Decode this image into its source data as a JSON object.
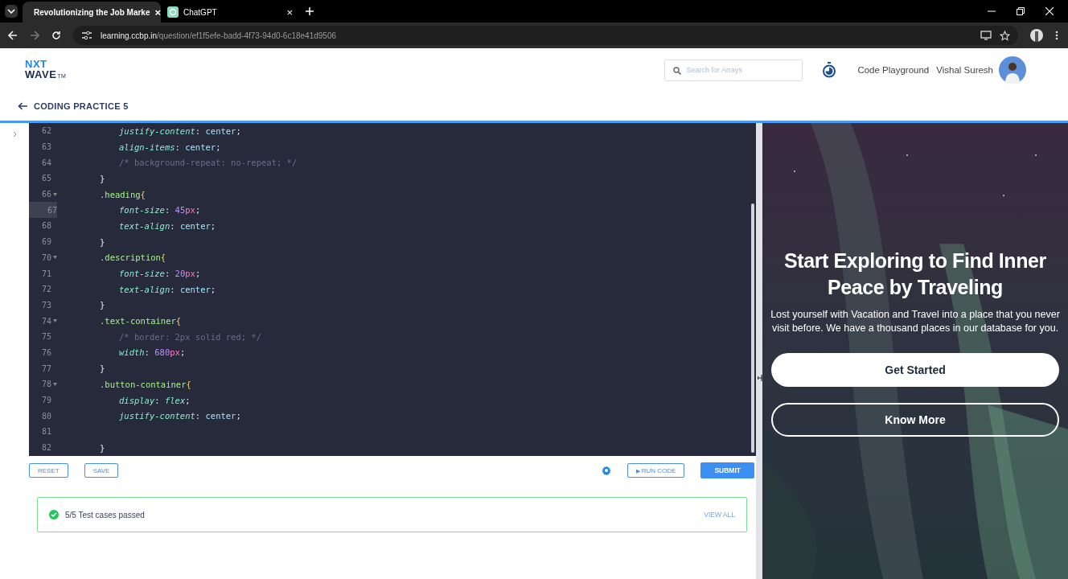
{
  "browser": {
    "tabs": [
      {
        "title": "Revolutionizing the Job Marke",
        "close": "×",
        "selected": true
      },
      {
        "title": "ChatGPT",
        "close": "×",
        "selected": false
      }
    ],
    "url_host": "learning.ccbp.in",
    "url_path": "/question/ef1f5efe-badd-4f73-94d0-6c18e41d9506"
  },
  "header": {
    "logo_top": "NXT",
    "logo_bottom": "WAVE",
    "logo_mark": "TM",
    "search": {
      "placeholder": "Search for Arrays"
    },
    "links": [
      "Code Playground",
      "Vishal Suresh"
    ],
    "breadcrumb": "CODING PRACTICE 5"
  },
  "editor": {
    "lines": [
      {
        "number": "62",
        "kind": "declaration",
        "foldable": false,
        "selected": false,
        "tokens": [
          {
            "kind": "prop",
            "text": "justify-content"
          },
          {
            "kind": "punct",
            "text": ": "
          },
          {
            "kind": "value",
            "text": "center"
          },
          {
            "kind": "punct",
            "text": ";"
          }
        ]
      },
      {
        "number": "63",
        "kind": "declaration",
        "foldable": false,
        "selected": false,
        "tokens": [
          {
            "kind": "prop",
            "text": "align-items"
          },
          {
            "kind": "punct",
            "text": ": "
          },
          {
            "kind": "value",
            "text": "center"
          },
          {
            "kind": "punct",
            "text": ";"
          }
        ]
      },
      {
        "number": "64",
        "kind": "declaration",
        "foldable": false,
        "selected": false,
        "tokens": [
          {
            "kind": "comment",
            "text": "/* background-repeat: no-repeat; */"
          }
        ]
      },
      {
        "number": "65",
        "kind": "rule",
        "foldable": false,
        "selected": false,
        "tokens": [
          {
            "kind": "punct",
            "text": "}"
          }
        ]
      },
      {
        "number": "66",
        "kind": "rule",
        "foldable": true,
        "selected": false,
        "tokens": [
          {
            "kind": "selector",
            "text": ".heading"
          },
          {
            "kind": "brace",
            "text": "{"
          }
        ]
      },
      {
        "number": "67",
        "kind": "declaration",
        "foldable": false,
        "selected": true,
        "tokens": [
          {
            "kind": "prop",
            "text": "font-size"
          },
          {
            "kind": "punct",
            "text": ": "
          },
          {
            "kind": "num",
            "text": "45"
          },
          {
            "kind": "unit",
            "text": "px"
          },
          {
            "kind": "punct",
            "text": ";"
          }
        ]
      },
      {
        "number": "68",
        "kind": "declaration",
        "foldable": false,
        "selected": false,
        "tokens": [
          {
            "kind": "prop",
            "text": "text-align"
          },
          {
            "kind": "punct",
            "text": ": "
          },
          {
            "kind": "value",
            "text": "center"
          },
          {
            "kind": "punct",
            "text": ";"
          }
        ]
      },
      {
        "number": "69",
        "kind": "rule",
        "foldable": false,
        "selected": false,
        "tokens": [
          {
            "kind": "punct",
            "text": "}"
          }
        ]
      },
      {
        "number": "70",
        "kind": "rule",
        "foldable": true,
        "selected": false,
        "tokens": [
          {
            "kind": "selector",
            "text": ".description"
          },
          {
            "kind": "brace",
            "text": "{"
          }
        ]
      },
      {
        "number": "71",
        "kind": "declaration",
        "foldable": false,
        "selected": false,
        "tokens": [
          {
            "kind": "prop",
            "text": "font-size"
          },
          {
            "kind": "punct",
            "text": ": "
          },
          {
            "kind": "num",
            "text": "20"
          },
          {
            "kind": "unit",
            "text": "px"
          },
          {
            "kind": "punct",
            "text": ";"
          }
        ]
      },
      {
        "number": "72",
        "kind": "declaration",
        "foldable": false,
        "selected": false,
        "tokens": [
          {
            "kind": "prop",
            "text": "text-align"
          },
          {
            "kind": "punct",
            "text": ": "
          },
          {
            "kind": "value",
            "text": "center"
          },
          {
            "kind": "punct",
            "text": ";"
          }
        ]
      },
      {
        "number": "73",
        "kind": "rule",
        "foldable": false,
        "selected": false,
        "tokens": [
          {
            "kind": "punct",
            "text": "}"
          }
        ]
      },
      {
        "number": "74",
        "kind": "rule",
        "foldable": true,
        "selected": false,
        "tokens": [
          {
            "kind": "selector",
            "text": ".text-container"
          },
          {
            "kind": "brace",
            "text": "{"
          }
        ]
      },
      {
        "number": "75",
        "kind": "declaration",
        "foldable": false,
        "selected": false,
        "tokens": [
          {
            "kind": "comment",
            "text": "/* border: 2px solid red; */"
          }
        ]
      },
      {
        "number": "76",
        "kind": "declaration",
        "foldable": false,
        "selected": false,
        "tokens": [
          {
            "kind": "prop",
            "text": "width"
          },
          {
            "kind": "punct",
            "text": ": "
          },
          {
            "kind": "num",
            "text": "680"
          },
          {
            "kind": "unit",
            "text": "px"
          },
          {
            "kind": "punct",
            "text": ";"
          }
        ]
      },
      {
        "number": "77",
        "kind": "rule",
        "foldable": false,
        "selected": false,
        "tokens": [
          {
            "kind": "punct",
            "text": "}"
          }
        ]
      },
      {
        "number": "78",
        "kind": "rule",
        "foldable": true,
        "selected": false,
        "tokens": [
          {
            "kind": "selector",
            "text": ".button-container"
          },
          {
            "kind": "brace",
            "text": "{"
          }
        ]
      },
      {
        "number": "79",
        "kind": "declaration",
        "foldable": false,
        "selected": false,
        "tokens": [
          {
            "kind": "prop",
            "text": "display"
          },
          {
            "kind": "punct",
            "text": ": "
          },
          {
            "kind": "keyword",
            "text": "flex"
          },
          {
            "kind": "punct",
            "text": ";"
          }
        ]
      },
      {
        "number": "80",
        "kind": "declaration",
        "foldable": false,
        "selected": false,
        "tokens": [
          {
            "kind": "prop",
            "text": "justify-content"
          },
          {
            "kind": "punct",
            "text": ": "
          },
          {
            "kind": "value",
            "text": "center"
          },
          {
            "kind": "punct",
            "text": ";"
          }
        ]
      },
      {
        "number": "81",
        "foldable": false,
        "selected": false
      },
      {
        "number": "82",
        "kind": "rule",
        "foldable": false,
        "selected": false,
        "tokens": [
          {
            "kind": "punct",
            "text": "}"
          }
        ]
      }
    ]
  },
  "toolbar": {
    "left": [
      "RESET",
      "SAVE"
    ],
    "run": "RUN CODE",
    "run_icon": "▶",
    "submit": "SUBMIT"
  },
  "result": {
    "text": "5/5 Test cases passed",
    "link": "VIEW ALL"
  },
  "preview": {
    "heading": "Start Exploring to Find Inner Peace by Traveling",
    "paragraph": "Lost yourself with Vacation and Travel into a place that you never visit before. We have a thousand places in our database for you.",
    "buttons": [
      {
        "label": "Get Started",
        "kind": "filled"
      },
      {
        "label": "Know More",
        "kind": "outline"
      }
    ]
  }
}
